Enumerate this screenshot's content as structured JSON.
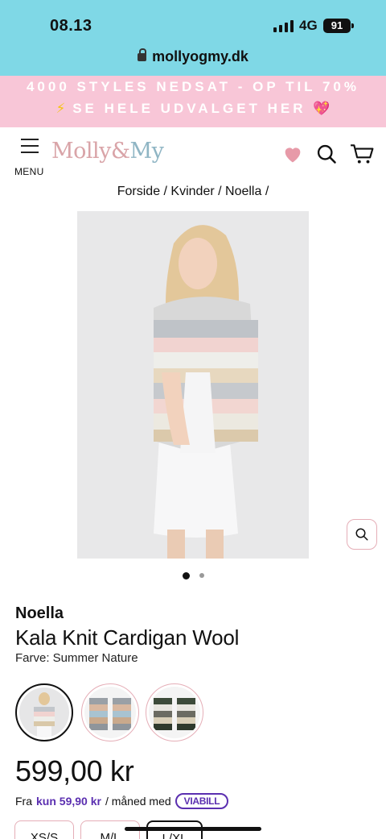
{
  "status_bar": {
    "time": "08.13",
    "network": "4G",
    "battery": "91"
  },
  "browser": {
    "url": "mollyogmy.dk"
  },
  "promo": {
    "line1": "4000 STYLES NEDSAT - OP TIL 70%",
    "line2": "SE HELE UDVALGET HER",
    "bolt_icon": "⚡",
    "heart_icon": "💖"
  },
  "header": {
    "menu_label": "MENU",
    "logo": {
      "molly": "Molly",
      "amp": "&",
      "my": "My"
    },
    "icons": [
      "heart-icon",
      "search-icon",
      "cart-icon"
    ]
  },
  "breadcrumb": "Forside / Kvinder / Noella /",
  "gallery": {
    "image_count": 2,
    "active_index": 0
  },
  "product": {
    "brand": "Noella",
    "title": "Kala Knit Cardigan Wool",
    "color_line": "Farve: Summer Nature",
    "price": "599,00 kr",
    "viabill": {
      "prefix": "Fra",
      "amount": "kun 59,90 kr",
      "suffix": "/ måned med",
      "logo": "VIABILL"
    },
    "sizes": [
      {
        "label": "XS/S",
        "selected": false
      },
      {
        "label": "M/L",
        "selected": false
      },
      {
        "label": "L/XL",
        "selected": true
      }
    ]
  },
  "colors": {
    "accent_pink": "#f8c6d7",
    "status_cyan": "#7fd8e6",
    "viabill_purple": "#5b2fb0"
  }
}
